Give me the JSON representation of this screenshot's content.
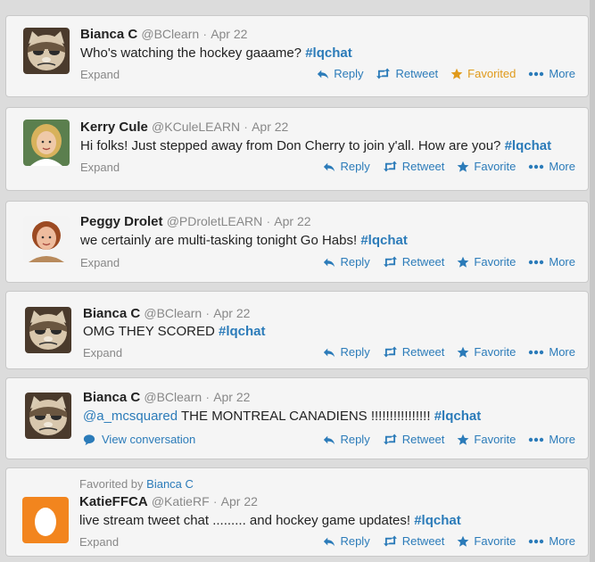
{
  "colors": {
    "link": "#2b7bb9",
    "favorited": "#e09a1a",
    "meta": "#888888"
  },
  "tweets": [
    {
      "name": "Bianca C",
      "handle": "@BClearn",
      "sep": "·",
      "date": "Apr 22",
      "text": "Who's watching the hockey gaaame? ",
      "hashtag": "#lqchat",
      "expand": "Expand",
      "avatar": "grumpy-cat-avatar",
      "actions": {
        "reply": "Reply",
        "retweet": "Retweet",
        "favorite": "Favorited",
        "more": "More"
      }
    },
    {
      "name": "Kerry Cule",
      "handle": "@KCuleLEARN",
      "sep": "·",
      "date": "Apr 22",
      "text": "Hi folks! Just stepped away from Don Cherry to join y'all. How are you? ",
      "hashtag": "#lqchat",
      "expand": "Expand",
      "avatar": "woman-avatar",
      "actions": {
        "reply": "Reply",
        "retweet": "Retweet",
        "favorite": "Favorite",
        "more": "More"
      }
    },
    {
      "name": "Peggy Drolet",
      "handle": "@PDroletLEARN",
      "sep": "·",
      "date": "Apr 22",
      "text": "we certainly are multi-tasking tonight Go Habs! ",
      "hashtag": "#lqchat",
      "expand": "Expand",
      "avatar": "woman-avatar",
      "actions": {
        "reply": "Reply",
        "retweet": "Retweet",
        "favorite": "Favorite",
        "more": "More"
      }
    },
    {
      "name": "Bianca C",
      "handle": "@BClearn",
      "sep": "·",
      "date": "Apr 22",
      "text": "OMG THEY SCORED ",
      "hashtag": "#lqchat",
      "expand": "Expand",
      "avatar": "grumpy-cat-avatar",
      "actions": {
        "reply": "Reply",
        "retweet": "Retweet",
        "favorite": "Favorite",
        "more": "More"
      }
    },
    {
      "name": "Bianca C",
      "handle": "@BClearn",
      "sep": "·",
      "date": "Apr 22",
      "mention": "@a_mcsquared",
      "text": " THE MONTREAL CANADIENS !!!!!!!!!!!!!!!! ",
      "hashtag": "#lqchat",
      "view_conversation": "View conversation",
      "avatar": "grumpy-cat-avatar",
      "actions": {
        "reply": "Reply",
        "retweet": "Retweet",
        "favorite": "Favorite",
        "more": "More"
      }
    },
    {
      "context_prefix": "Favorited by ",
      "context_user": "Bianca C",
      "name": "KatieFFCA",
      "handle": "@KatieRF",
      "sep": "·",
      "date": "Apr 22",
      "text": "live stream tweet chat ......... and hockey game updates! ",
      "hashtag": "#lqchat",
      "expand": "Expand",
      "avatar": "egg-avatar",
      "actions": {
        "reply": "Reply",
        "retweet": "Retweet",
        "favorite": "Favorite",
        "more": "More"
      }
    }
  ]
}
